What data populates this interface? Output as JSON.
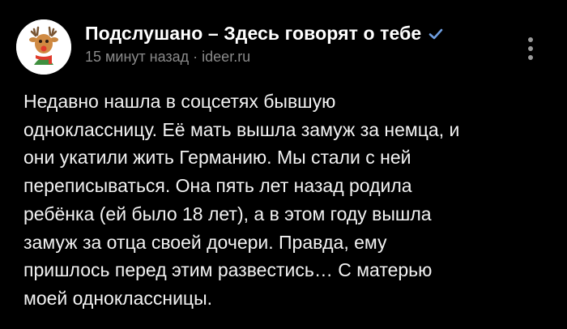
{
  "post": {
    "author": "Подслушано – Здесь говорят о тебе",
    "time": "15 минут назад",
    "separator": "·",
    "source": "ideer.ru",
    "text_lines": [
      "Недавно нашла в соцсетях бывшую",
      "одноклассницу. Её мать вышла замуж за немца, и",
      "они укатили жить Германию. Мы стали с ней",
      "переписываться. Она пять лет назад родила",
      "ребёнка (ей было 18 лет), а в этом году вышла",
      "замуж за отца своей дочери. Правда, ему",
      "пришлось перед этим развестись… С матерью",
      "моей одноклассницы."
    ]
  },
  "icons": {
    "verified": "checkmark-icon",
    "menu": "more-vertical-icon",
    "avatar": "reindeer-logo"
  },
  "colors": {
    "background": "#000000",
    "accent": "#6f9ee0",
    "muted_text": "#8a8a8a"
  }
}
